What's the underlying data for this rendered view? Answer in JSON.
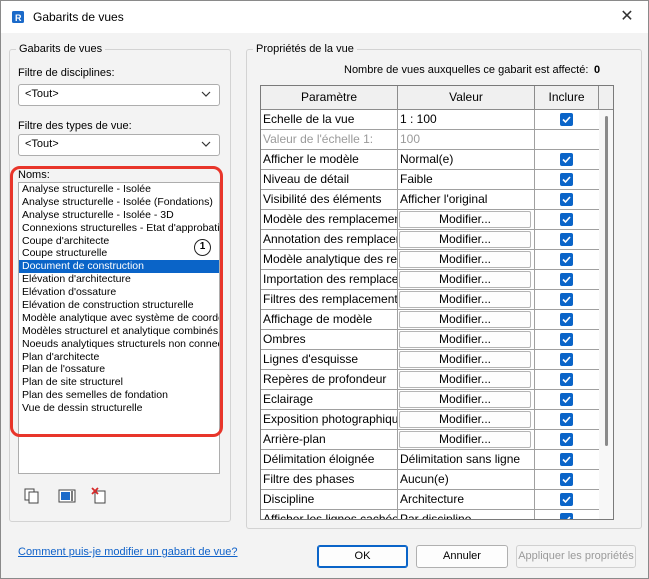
{
  "window": {
    "title": "Gabarits de vues",
    "close_glyph": "✕"
  },
  "left": {
    "group_title": "Gabarits de vues",
    "discipline_filter": {
      "label": "Filtre de disciplines:",
      "value": "<Tout>"
    },
    "viewtype_filter": {
      "label": "Filtre des types de vue:",
      "value": "<Tout>"
    },
    "names_label": "Noms:",
    "names": [
      "Analyse structurelle - Isolée",
      "Analyse structurelle - Isolée (Fondations)",
      "Analyse structurelle - Isolée - 3D",
      "Connexions structurelles - Etat d'approbation",
      "Coupe d'architecte",
      "Coupe structurelle",
      "Document de construction",
      "Elévation d'architecture",
      "Elévation d'ossature",
      "Elévation de construction structurelle",
      "Modèle analytique avec système de coordonnées",
      "Modèles structurel et analytique combinés",
      "Noeuds analytiques structurels non connectés",
      "Plan d'architecte",
      "Plan de l'ossature",
      "Plan de site structurel",
      "Plan des semelles de fondation",
      "Vue de dessin structurelle"
    ],
    "selected_index": 6,
    "callout_number": "1",
    "help_link": "Comment puis-je modifier un gabarit de vue?"
  },
  "right": {
    "group_title": "Propriétés de la vue",
    "count_label": "Nombre de vues auxquelles ce gabarit est affecté:",
    "count_value": "0",
    "columns": {
      "param": "Paramètre",
      "value": "Valeur",
      "include": "Inclure"
    },
    "rows": [
      {
        "param": "Echelle de la vue",
        "value": "1 : 100",
        "kind": "text",
        "include": true
      },
      {
        "param": "Valeur de l'échelle   1:",
        "value": "100",
        "kind": "text",
        "include": null,
        "disabled": true
      },
      {
        "param": "Afficher le modèle",
        "value": "Normal(e)",
        "kind": "text",
        "include": true
      },
      {
        "param": "Niveau de détail",
        "value": "Faible",
        "kind": "text",
        "include": true
      },
      {
        "param": "Visibilité des éléments",
        "value": "Afficher l'original",
        "kind": "text",
        "include": true
      },
      {
        "param": "Modèle des remplacements",
        "value": "Modifier...",
        "kind": "button",
        "include": true
      },
      {
        "param": "Annotation des remplacements",
        "value": "Modifier...",
        "kind": "button",
        "include": true
      },
      {
        "param": "Modèle analytique des remplacements",
        "value": "Modifier...",
        "kind": "button",
        "include": true
      },
      {
        "param": "Importation des remplacements",
        "value": "Modifier...",
        "kind": "button",
        "include": true
      },
      {
        "param": "Filtres des remplacements",
        "value": "Modifier...",
        "kind": "button",
        "include": true
      },
      {
        "param": "Affichage de modèle",
        "value": "Modifier...",
        "kind": "button",
        "include": true
      },
      {
        "param": "Ombres",
        "value": "Modifier...",
        "kind": "button",
        "include": true
      },
      {
        "param": "Lignes d'esquisse",
        "value": "Modifier...",
        "kind": "button",
        "include": true
      },
      {
        "param": "Repères de profondeur",
        "value": "Modifier...",
        "kind": "button",
        "include": true
      },
      {
        "param": "Eclairage",
        "value": "Modifier...",
        "kind": "button",
        "include": true
      },
      {
        "param": "Exposition photographique",
        "value": "Modifier...",
        "kind": "button",
        "include": true
      },
      {
        "param": "Arrière-plan",
        "value": "Modifier...",
        "kind": "button",
        "include": true
      },
      {
        "param": "Délimitation éloignée",
        "value": "Délimitation sans ligne",
        "kind": "text",
        "include": true
      },
      {
        "param": "Filtre des phases",
        "value": "Aucun(e)",
        "kind": "text",
        "include": true
      },
      {
        "param": "Discipline",
        "value": "Architecture",
        "kind": "text",
        "include": true
      },
      {
        "param": "Afficher les lignes cachées",
        "value": "Par discipline",
        "kind": "text",
        "include": true
      }
    ]
  },
  "buttons": {
    "ok": "OK",
    "cancel": "Annuler",
    "apply": "Appliquer les propriétés"
  },
  "colors": {
    "accent": "#0a64c8",
    "highlight": "#e8352a",
    "link": "#1062c9"
  }
}
